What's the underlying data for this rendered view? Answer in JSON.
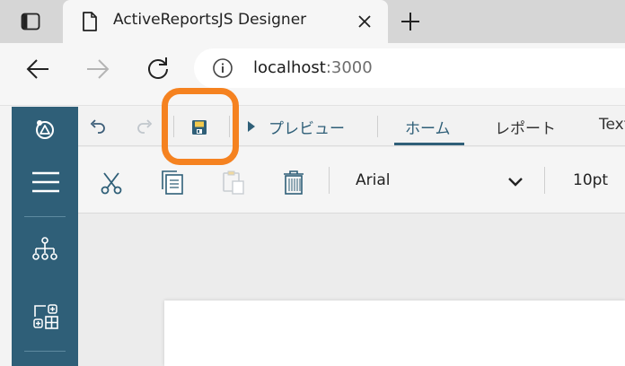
{
  "browser": {
    "tab_title": "ActiveReportsJS Designer",
    "url_host": "localhost",
    "url_port": ":3000"
  },
  "designer": {
    "preview_label": "プレビュー",
    "tabs": [
      {
        "label": "ホーム",
        "active": true
      },
      {
        "label": "レポート",
        "active": false
      },
      {
        "label": "Text",
        "active": false
      }
    ],
    "font_family_value": "Arial",
    "font_size_value": "10pt"
  },
  "colors": {
    "sidebar": "#2f5f78",
    "accent": "#2f5f78",
    "highlight": "#f58220",
    "save_icon_label": "#f2c94c"
  },
  "icons": {
    "tab_actions": "tab-actions-icon",
    "favicon": "document-icon",
    "close": "close-icon",
    "new_tab": "plus-icon",
    "back": "arrow-left-icon",
    "forward": "arrow-right-icon",
    "refresh": "refresh-icon",
    "site_info": "info-icon",
    "undo": "undo-icon",
    "redo": "redo-icon",
    "save": "floppy-disk-icon",
    "preview": "play-icon",
    "cut": "scissors-icon",
    "copy": "copy-icon",
    "paste": "clipboard-icon",
    "delete": "trash-icon",
    "dropdown": "chevron-down-icon",
    "menu": "hamburger-icon",
    "report_explorer": "hierarchy-icon",
    "toolbox": "toolbox-icon"
  }
}
